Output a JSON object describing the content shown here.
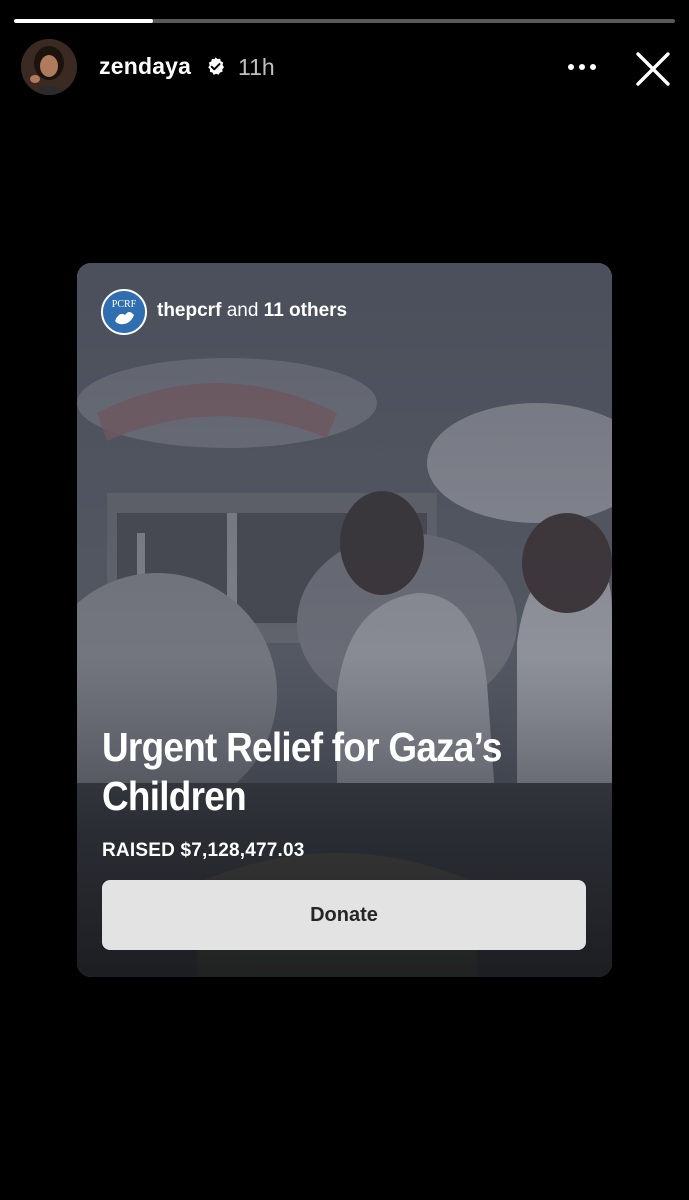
{
  "story": {
    "progress": 0.21,
    "username": "zendaya",
    "time_ago": "11h"
  },
  "fundraiser": {
    "organizer": "thepcrf",
    "organizer_logo_text": "PCRF",
    "and_word": "and",
    "others": "11 others",
    "title": "Urgent Relief for Gaza’s Children",
    "raised": "RAISED $7,128,477.03",
    "donate_label": "Donate"
  },
  "icons": {
    "verified": "verified-badge-icon",
    "more": "more-options-icon",
    "close": "close-icon"
  },
  "colors": {
    "background": "#000000",
    "verified_badge": "#ffffff",
    "logo_blue": "#2f6fb1",
    "button_bg": "#ebebeb"
  }
}
